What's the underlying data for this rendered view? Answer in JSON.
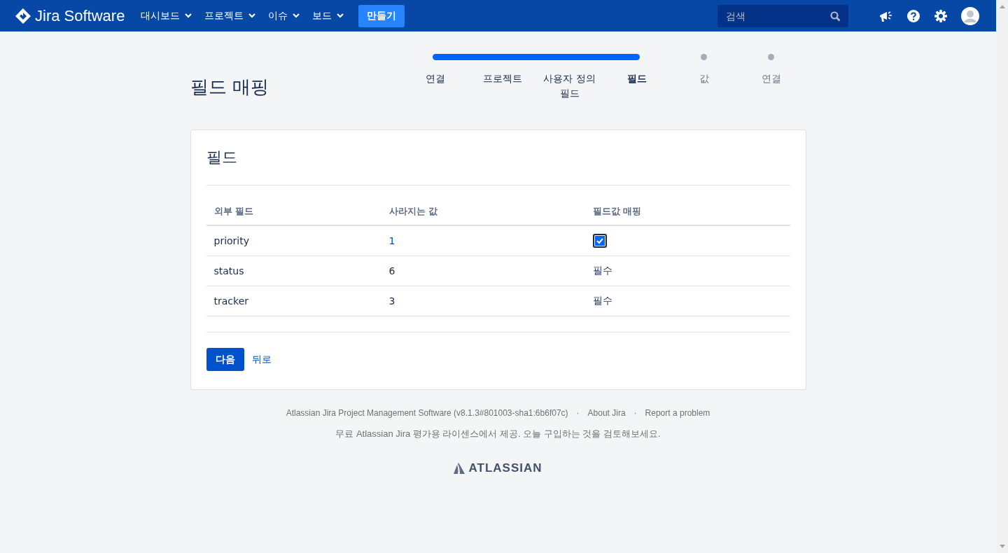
{
  "header": {
    "logo": "Jira Software",
    "menus": [
      {
        "label": "대시보드"
      },
      {
        "label": "프로젝트"
      },
      {
        "label": "이슈"
      },
      {
        "label": "보드"
      }
    ],
    "create_button": "만들기",
    "search": {
      "placeholder": "검색"
    }
  },
  "page": {
    "title": "필드 매핑",
    "steps": [
      {
        "label": "연결",
        "completed": true,
        "selected": false
      },
      {
        "label": "프로젝트",
        "completed": true,
        "selected": false
      },
      {
        "label": "사용자 정의 필드",
        "completed": true,
        "selected": false
      },
      {
        "label": "필드",
        "completed": true,
        "selected": true
      },
      {
        "label": "값",
        "completed": false,
        "selected": false
      },
      {
        "label": "연결",
        "completed": false,
        "selected": false
      }
    ]
  },
  "card": {
    "title": "필드",
    "table": {
      "columns": [
        "외부 필드",
        "사라지는 값",
        "필드값 매핑"
      ],
      "rows": [
        {
          "field": "priority",
          "value": "1",
          "value_link": true,
          "mapping": {
            "kind": "checkbox",
            "checked": true
          }
        },
        {
          "field": "status",
          "value": "6",
          "value_link": false,
          "mapping": {
            "kind": "text",
            "text": "필수"
          }
        },
        {
          "field": "tracker",
          "value": "3",
          "value_link": false,
          "mapping": {
            "kind": "text",
            "text": "필수"
          }
        }
      ]
    },
    "next_button": "다음",
    "back_link": "뒤로"
  },
  "footer": {
    "links": [
      "Atlassian Jira Project Management Software (v8.1.3#801003-sha1:6b6f07c)",
      "About Jira",
      "Report a problem"
    ],
    "separator": "·",
    "license": "무료 Atlassian Jira 평가용 라이센스에서 제공. 오늘 구입하는 것을 검토해보세요.",
    "brand": "ATLASSIAN"
  }
}
